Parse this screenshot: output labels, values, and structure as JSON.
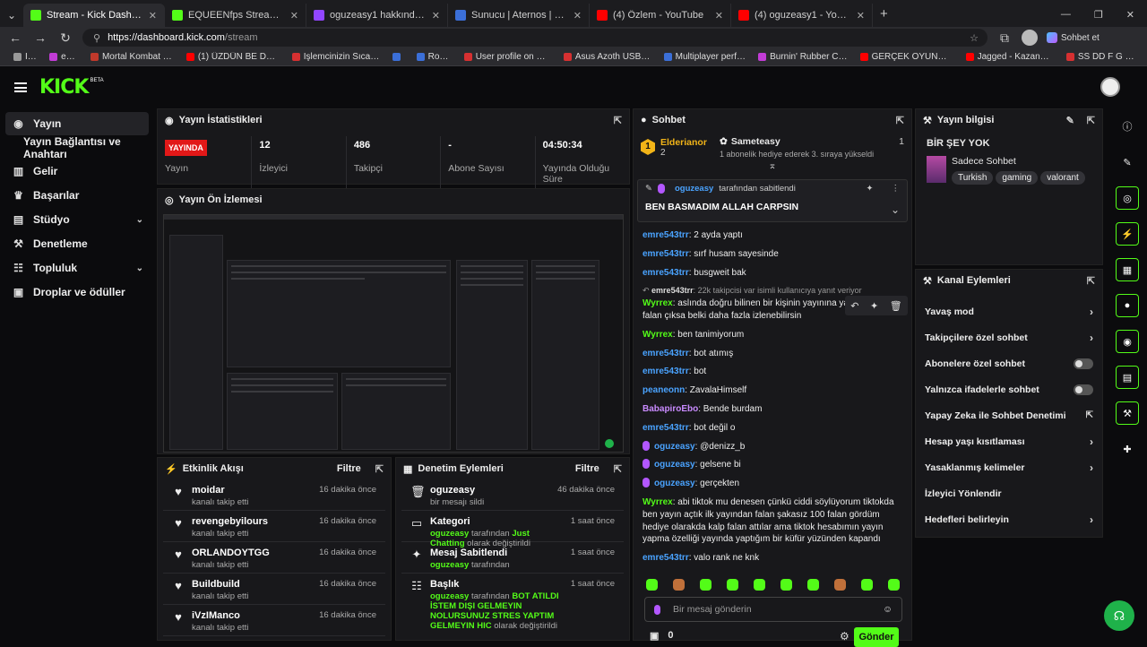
{
  "browser": {
    "tabs": [
      {
        "label": "Stream - Kick Dashboard",
        "color": "#53fc18",
        "active": true
      },
      {
        "label": "EQUEENfps Stream - Watch L",
        "color": "#53fc18"
      },
      {
        "label": "oguzeasy1 hakkında - Twitch",
        "color": "#9146ff"
      },
      {
        "label": "Sunucu | Aternos | Ücretsiz Minecr",
        "color": "#3b6fd8"
      },
      {
        "label": "(4) Özlem - YouTube",
        "color": "#ff0000"
      },
      {
        "label": "(4) oguzeasy1 - YouTube",
        "color": "#ff0000"
      }
    ],
    "url_host": "https://dashboard.kick.com",
    "url_path": "/stream",
    "profile_label": "Sohbet et",
    "bookmarks": [
      {
        "label": "İFF",
        "color": "#999"
      },
      {
        "label": "eyes",
        "color": "#c23cd6"
      },
      {
        "label": "Mortal Kombat 11...",
        "color": "#c0392b"
      },
      {
        "label": "(1) ÜZDÜN BE DED...",
        "color": "#ff0000"
      },
      {
        "label": "İşlemcinizin Sıcaklı...",
        "color": "#d63031"
      },
      {
        "label": "",
        "color": "#3b6fd8"
      },
      {
        "label": "Robux",
        "color": "#3b6fd8"
      },
      {
        "label": "User profile on Hel...",
        "color": "#d63031"
      },
      {
        "label": "Asus Azoth USB D...",
        "color": "#d63031"
      },
      {
        "label": "Multiplayer perfor...",
        "color": "#3b6fd8"
      },
      {
        "label": "Burnin' Rubber Cra...",
        "color": "#c23cd6"
      },
      {
        "label": "GERÇEK OYUNU K...",
        "color": "#ff0000"
      },
      {
        "label": "Jagged - Kazanma...",
        "color": "#ff0000"
      },
      {
        "label": "SS DD F G GN...",
        "color": "#d63031"
      }
    ]
  },
  "kick": {
    "logo": "KICK",
    "beta": "BETA"
  },
  "sidebar": {
    "items": [
      {
        "label": "Yayın",
        "icon": "broadcast-icon"
      },
      {
        "label": "Yayın Bağlantısı ve Anahtarı"
      },
      {
        "label": "Gelir",
        "icon": "chart-icon"
      },
      {
        "label": "Başarılar",
        "icon": "trophy-icon"
      },
      {
        "label": "Stüdyo",
        "icon": "studio-icon"
      },
      {
        "label": "Denetleme",
        "icon": "wrench-icon"
      },
      {
        "label": "Topluluk",
        "icon": "community-icon"
      },
      {
        "label": "Droplar ve ödüller",
        "icon": "gift-icon"
      }
    ]
  },
  "stats": {
    "title": "Yayın İstatistikleri",
    "badge": "YAYINDA",
    "items": [
      {
        "value": "",
        "label": "Yayın"
      },
      {
        "value": "12",
        "label": "İzleyici"
      },
      {
        "value": "486",
        "label": "Takipçi"
      },
      {
        "value": "-",
        "label": "Abone Sayısı"
      },
      {
        "value": "04:50:34",
        "label": "Yayında Olduğu Süre"
      }
    ]
  },
  "preview": {
    "title": "Yayın Ön İzlemesi"
  },
  "feed": {
    "title": "Etkinlik Akışı",
    "filter": "Filtre",
    "items": [
      {
        "name": "moidar",
        "sub": "kanalı takip etti",
        "time": "16 dakika önce"
      },
      {
        "name": "revengebyilours",
        "sub": "kanalı takip etti",
        "time": "16 dakika önce"
      },
      {
        "name": "ORLANDOYTGG",
        "sub": "kanalı takip etti",
        "time": "16 dakika önce"
      },
      {
        "name": "Buildbuild",
        "sub": "kanalı takip etti",
        "time": "16 dakika önce"
      },
      {
        "name": "iVzIManco",
        "sub": "kanalı takip etti",
        "time": "16 dakika önce"
      }
    ]
  },
  "modlog": {
    "title": "Denetim Eylemleri",
    "filter": "Filtre",
    "items": [
      {
        "name": "oguzeasy",
        "pre": "",
        "mid": "bir mesajı sildi",
        "hl": "",
        "post": "",
        "time": "46 dakika önce",
        "icon": "trash-icon"
      },
      {
        "name": "Kategori",
        "pre": "oguzeasy",
        "mid": "tarafından",
        "hl": "Just Chatting",
        "post": "olarak değiştirildi",
        "time": "1 saat önce",
        "icon": "category-icon"
      },
      {
        "name": "Mesaj Sabitlendi",
        "pre": "oguzeasy",
        "mid": "tarafından",
        "hl": "",
        "post": "",
        "time": "1 saat önce",
        "icon": "pin-icon"
      },
      {
        "name": "Başlık",
        "pre": "oguzeasy",
        "mid": "tarafından",
        "hl": "BOT ATILDI İSTEM DIŞI GELMEYIN NOLURSUNUZ STRES YAPTIM GELMEYIN HIC",
        "post": "olarak değiştirildi",
        "time": "1 saat önce",
        "icon": "title-icon"
      }
    ]
  },
  "chat": {
    "title": "Sohbet",
    "top1": {
      "rank": "1",
      "name": "Elderianor",
      "count": "2"
    },
    "top2": {
      "name": "Sameteasy",
      "count": "1",
      "desc": "1 abonelik hediye ederek 3. sıraya yükseldi"
    },
    "pinned": {
      "by": "oguzeasy",
      "by_suffix": "tarafından sabitlendi",
      "msg": "BEN BASMADIM ALLAH CARPSIN"
    },
    "messages": [
      {
        "user": "emre543trr",
        "color": "#4aa3ff",
        "text": "2 ayda yaptı",
        "mod": false
      },
      {
        "user": "emre543trr",
        "color": "#4aa3ff",
        "text": "sırf husam sayesinde",
        "mod": false
      },
      {
        "user": "emre543trr",
        "color": "#4aa3ff",
        "text": "busgweit bak",
        "mod": false
      },
      {
        "user": "Wyrrex",
        "color": "#53fc18",
        "text": "aslında doğru bilinen bir kişinin yayınına yada videosuna falan çıksa belki daha fazla izlenebilirsin",
        "mod": false
      },
      {
        "user": "Wyrrex",
        "color": "#53fc18",
        "text": "ben tanimiyorum",
        "mod": false
      },
      {
        "user": "emre543trr",
        "color": "#4aa3ff",
        "text": "bot atımış",
        "mod": false
      },
      {
        "user": "emre543trr",
        "color": "#4aa3ff",
        "text": "bot",
        "mod": false
      },
      {
        "user": "peaneonn",
        "color": "#4aa3ff",
        "text": "ZavalaHimself",
        "mod": false
      },
      {
        "user": "BabapiroEbo",
        "color": "#c98bff",
        "text": "Bende burdam",
        "mod": false
      },
      {
        "user": "emre543trr",
        "color": "#4aa3ff",
        "text": "bot değil o",
        "mod": false
      },
      {
        "user": "oguzeasy",
        "color": "#4aa3ff",
        "text": "@denizz_b",
        "mod": true
      },
      {
        "user": "oguzeasy",
        "color": "#4aa3ff",
        "text": "gelsene bi",
        "mod": true
      },
      {
        "user": "oguzeasy",
        "color": "#4aa3ff",
        "text": "gerçekten",
        "mod": true
      },
      {
        "user": "Wyrrex",
        "color": "#53fc18",
        "text": "abi tiktok mu denesen çünkü ciddi söylüyorum tiktokda ben yayın açtık ilk yayından falan şakasız 100 falan gördüm hediye olarakda kalp falan attılar ama tiktok hesabımın yayın yapma özelliği yayında yaptığım bir küfür yüzünden kapandı",
        "mod": false
      },
      {
        "user": "emre543trr",
        "color": "#4aa3ff",
        "text": "valo rank ne knk",
        "mod": false
      }
    ],
    "reply_hint": {
      "user": "emre543trr",
      "text": "22k takipcisi var isimli kullanıcıya yanıt veriyor"
    },
    "input_placeholder": "Bir mesaj gönderin",
    "gifts": "0",
    "send": "Gönder"
  },
  "info": {
    "title": "Yayın bilgisi",
    "stream_title": "BİR ŞEY YOK",
    "category": "Sadece Sohbet",
    "tags": [
      "Turkish",
      "gaming",
      "valorant"
    ]
  },
  "actions": {
    "title": "Kanal Eylemleri",
    "items": [
      {
        "label": "Yavaş mod",
        "kind": "chev"
      },
      {
        "label": "Takipçilere özel sohbet",
        "kind": "chev"
      },
      {
        "label": "Abonelere özel sohbet",
        "kind": "toggle"
      },
      {
        "label": "Yalnızca ifadelerle sohbet",
        "kind": "toggle"
      },
      {
        "label": "Yapay Zeka ile Sohbet Denetimi",
        "kind": "ext"
      },
      {
        "label": "Hesap yaşı kısıtlaması",
        "kind": "chev"
      },
      {
        "label": "Yasaklanmış kelimeler",
        "kind": "chev"
      },
      {
        "label": "İzleyici Yönlendir",
        "kind": "none"
      },
      {
        "label": "Hedefleri belirleyin",
        "kind": "chev"
      }
    ]
  }
}
